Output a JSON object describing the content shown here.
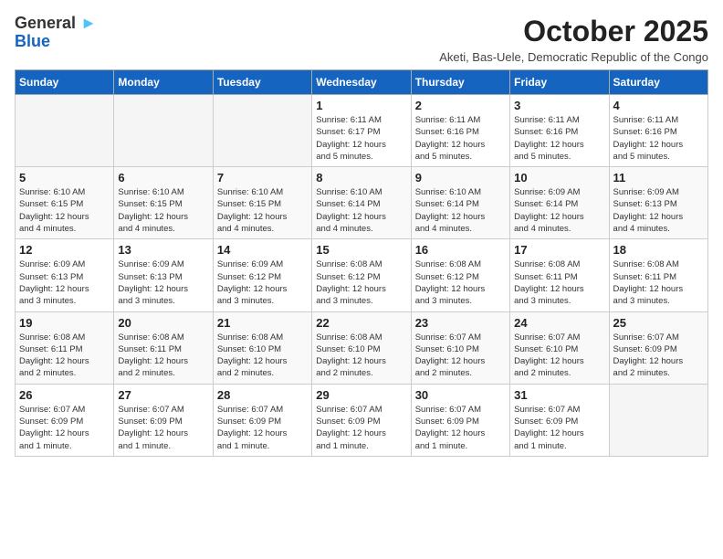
{
  "header": {
    "logo_general": "General",
    "logo_blue": "Blue",
    "month_title": "October 2025",
    "subtitle": "Aketi, Bas-Uele, Democratic Republic of the Congo"
  },
  "columns": [
    "Sunday",
    "Monday",
    "Tuesday",
    "Wednesday",
    "Thursday",
    "Friday",
    "Saturday"
  ],
  "weeks": [
    [
      {
        "day": "",
        "info": ""
      },
      {
        "day": "",
        "info": ""
      },
      {
        "day": "",
        "info": ""
      },
      {
        "day": "1",
        "info": "Sunrise: 6:11 AM\nSunset: 6:17 PM\nDaylight: 12 hours\nand 5 minutes."
      },
      {
        "day": "2",
        "info": "Sunrise: 6:11 AM\nSunset: 6:16 PM\nDaylight: 12 hours\nand 5 minutes."
      },
      {
        "day": "3",
        "info": "Sunrise: 6:11 AM\nSunset: 6:16 PM\nDaylight: 12 hours\nand 5 minutes."
      },
      {
        "day": "4",
        "info": "Sunrise: 6:11 AM\nSunset: 6:16 PM\nDaylight: 12 hours\nand 5 minutes."
      }
    ],
    [
      {
        "day": "5",
        "info": "Sunrise: 6:10 AM\nSunset: 6:15 PM\nDaylight: 12 hours\nand 4 minutes."
      },
      {
        "day": "6",
        "info": "Sunrise: 6:10 AM\nSunset: 6:15 PM\nDaylight: 12 hours\nand 4 minutes."
      },
      {
        "day": "7",
        "info": "Sunrise: 6:10 AM\nSunset: 6:15 PM\nDaylight: 12 hours\nand 4 minutes."
      },
      {
        "day": "8",
        "info": "Sunrise: 6:10 AM\nSunset: 6:14 PM\nDaylight: 12 hours\nand 4 minutes."
      },
      {
        "day": "9",
        "info": "Sunrise: 6:10 AM\nSunset: 6:14 PM\nDaylight: 12 hours\nand 4 minutes."
      },
      {
        "day": "10",
        "info": "Sunrise: 6:09 AM\nSunset: 6:14 PM\nDaylight: 12 hours\nand 4 minutes."
      },
      {
        "day": "11",
        "info": "Sunrise: 6:09 AM\nSunset: 6:13 PM\nDaylight: 12 hours\nand 4 minutes."
      }
    ],
    [
      {
        "day": "12",
        "info": "Sunrise: 6:09 AM\nSunset: 6:13 PM\nDaylight: 12 hours\nand 3 minutes."
      },
      {
        "day": "13",
        "info": "Sunrise: 6:09 AM\nSunset: 6:13 PM\nDaylight: 12 hours\nand 3 minutes."
      },
      {
        "day": "14",
        "info": "Sunrise: 6:09 AM\nSunset: 6:12 PM\nDaylight: 12 hours\nand 3 minutes."
      },
      {
        "day": "15",
        "info": "Sunrise: 6:08 AM\nSunset: 6:12 PM\nDaylight: 12 hours\nand 3 minutes."
      },
      {
        "day": "16",
        "info": "Sunrise: 6:08 AM\nSunset: 6:12 PM\nDaylight: 12 hours\nand 3 minutes."
      },
      {
        "day": "17",
        "info": "Sunrise: 6:08 AM\nSunset: 6:11 PM\nDaylight: 12 hours\nand 3 minutes."
      },
      {
        "day": "18",
        "info": "Sunrise: 6:08 AM\nSunset: 6:11 PM\nDaylight: 12 hours\nand 3 minutes."
      }
    ],
    [
      {
        "day": "19",
        "info": "Sunrise: 6:08 AM\nSunset: 6:11 PM\nDaylight: 12 hours\nand 2 minutes."
      },
      {
        "day": "20",
        "info": "Sunrise: 6:08 AM\nSunset: 6:11 PM\nDaylight: 12 hours\nand 2 minutes."
      },
      {
        "day": "21",
        "info": "Sunrise: 6:08 AM\nSunset: 6:10 PM\nDaylight: 12 hours\nand 2 minutes."
      },
      {
        "day": "22",
        "info": "Sunrise: 6:08 AM\nSunset: 6:10 PM\nDaylight: 12 hours\nand 2 minutes."
      },
      {
        "day": "23",
        "info": "Sunrise: 6:07 AM\nSunset: 6:10 PM\nDaylight: 12 hours\nand 2 minutes."
      },
      {
        "day": "24",
        "info": "Sunrise: 6:07 AM\nSunset: 6:10 PM\nDaylight: 12 hours\nand 2 minutes."
      },
      {
        "day": "25",
        "info": "Sunrise: 6:07 AM\nSunset: 6:09 PM\nDaylight: 12 hours\nand 2 minutes."
      }
    ],
    [
      {
        "day": "26",
        "info": "Sunrise: 6:07 AM\nSunset: 6:09 PM\nDaylight: 12 hours\nand 1 minute."
      },
      {
        "day": "27",
        "info": "Sunrise: 6:07 AM\nSunset: 6:09 PM\nDaylight: 12 hours\nand 1 minute."
      },
      {
        "day": "28",
        "info": "Sunrise: 6:07 AM\nSunset: 6:09 PM\nDaylight: 12 hours\nand 1 minute."
      },
      {
        "day": "29",
        "info": "Sunrise: 6:07 AM\nSunset: 6:09 PM\nDaylight: 12 hours\nand 1 minute."
      },
      {
        "day": "30",
        "info": "Sunrise: 6:07 AM\nSunset: 6:09 PM\nDaylight: 12 hours\nand 1 minute."
      },
      {
        "day": "31",
        "info": "Sunrise: 6:07 AM\nSunset: 6:09 PM\nDaylight: 12 hours\nand 1 minute."
      },
      {
        "day": "",
        "info": ""
      }
    ]
  ]
}
